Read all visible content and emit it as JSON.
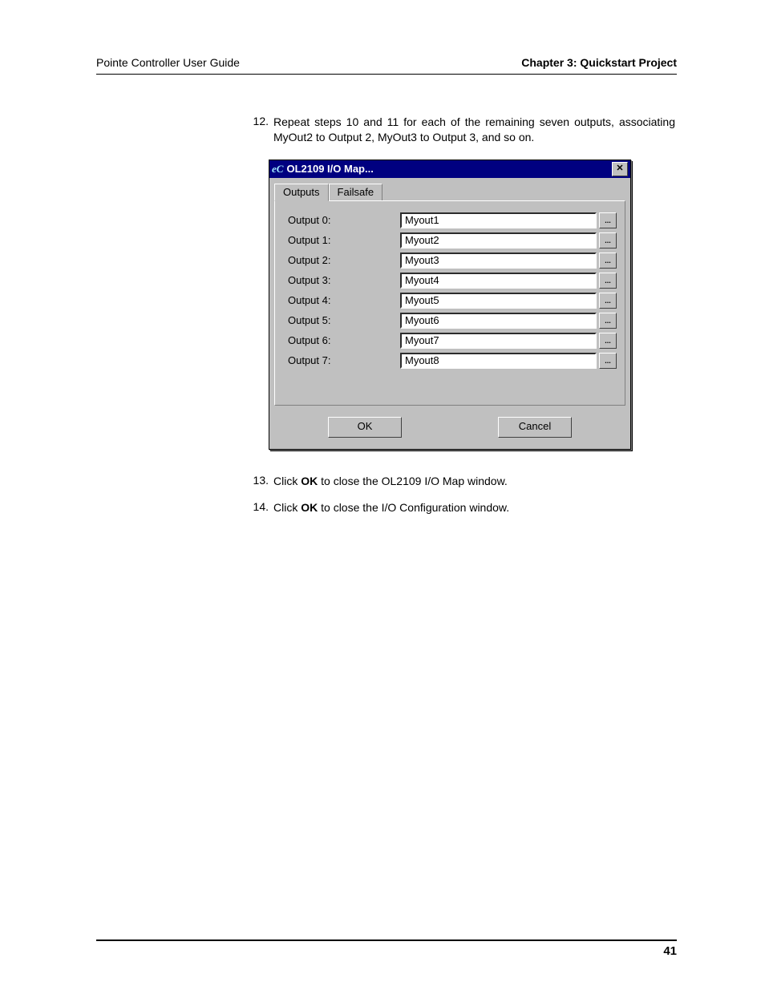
{
  "header": {
    "left": "Pointe Controller User Guide",
    "right": "Chapter 3: Quickstart Project"
  },
  "steps": {
    "s12": {
      "num": "12.",
      "text_a": "Repeat steps 10 and 11 for each of the remaining seven outputs, associating MyOut2 to Output 2, MyOut3 to Output 3, and so on."
    },
    "s13": {
      "num": "13.",
      "text_a": "Click ",
      "bold": "OK",
      "text_b": " to close the OL2109 I/O Map window."
    },
    "s14": {
      "num": "14.",
      "text_a": "Click ",
      "bold": "OK",
      "text_b": " to close the I/O Configuration window."
    }
  },
  "dialog": {
    "icon": "eC",
    "title": "OL2109 I/O Map...",
    "close": "✕",
    "tabs": {
      "outputs": "Outputs",
      "failsafe": "Failsafe"
    },
    "rows": [
      {
        "label": "Output 0:",
        "value": "Myout1"
      },
      {
        "label": "Output 1:",
        "value": "Myout2"
      },
      {
        "label": "Output 2:",
        "value": "Myout3"
      },
      {
        "label": "Output 3:",
        "value": "Myout4"
      },
      {
        "label": "Output 4:",
        "value": "Myout5"
      },
      {
        "label": "Output 5:",
        "value": "Myout6"
      },
      {
        "label": "Output 6:",
        "value": "Myout7"
      },
      {
        "label": "Output 7:",
        "value": "Myout8"
      }
    ],
    "browse": "...",
    "ok": "OK",
    "cancel": "Cancel"
  },
  "footer": {
    "page": "41"
  }
}
